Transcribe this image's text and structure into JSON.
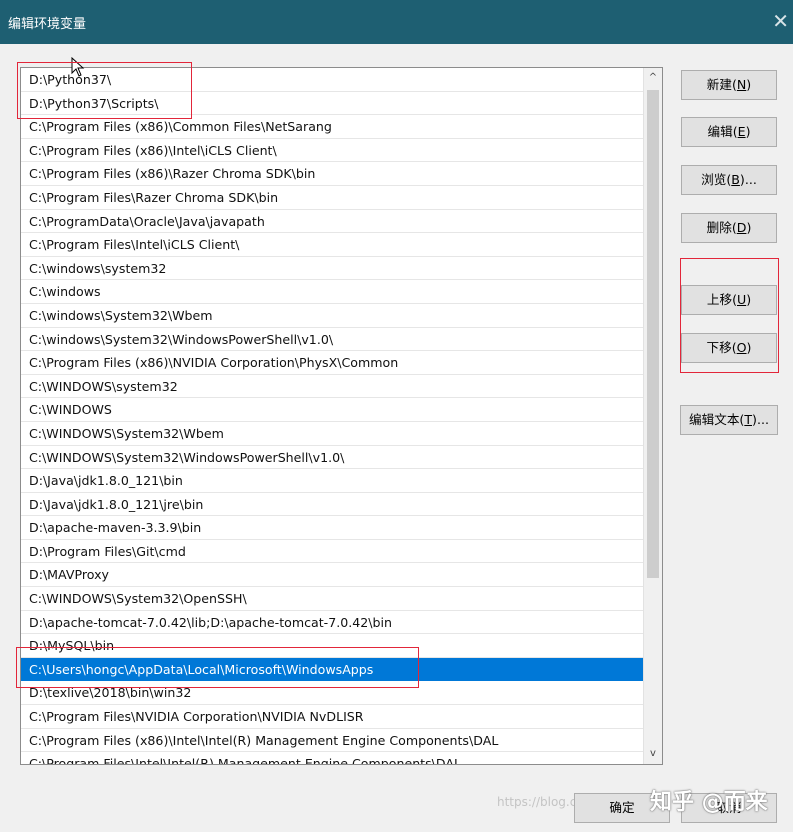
{
  "window": {
    "title": "编辑环境变量",
    "close_glyph": "✕"
  },
  "paths": [
    "D:\\Python37\\",
    "D:\\Python37\\Scripts\\",
    "C:\\Program Files (x86)\\Common Files\\NetSarang",
    "C:\\Program Files (x86)\\Intel\\iCLS Client\\",
    "C:\\Program Files (x86)\\Razer Chroma SDK\\bin",
    "C:\\Program Files\\Razer Chroma SDK\\bin",
    "C:\\ProgramData\\Oracle\\Java\\javapath",
    "C:\\Program Files\\Intel\\iCLS Client\\",
    "C:\\windows\\system32",
    "C:\\windows",
    "C:\\windows\\System32\\Wbem",
    "C:\\windows\\System32\\WindowsPowerShell\\v1.0\\",
    "C:\\Program Files (x86)\\NVIDIA Corporation\\PhysX\\Common",
    "C:\\WINDOWS\\system32",
    "C:\\WINDOWS",
    "C:\\WINDOWS\\System32\\Wbem",
    "C:\\WINDOWS\\System32\\WindowsPowerShell\\v1.0\\",
    "D:\\Java\\jdk1.8.0_121\\bin",
    "D:\\Java\\jdk1.8.0_121\\jre\\bin",
    "D:\\apache-maven-3.3.9\\bin",
    "D:\\Program Files\\Git\\cmd",
    "D:\\MAVProxy",
    "C:\\WINDOWS\\System32\\OpenSSH\\",
    "D:\\apache-tomcat-7.0.42\\lib;D:\\apache-tomcat-7.0.42\\bin",
    "D:\\MySQL\\bin",
    "C:\\Users\\hongc\\AppData\\Local\\Microsoft\\WindowsApps",
    "D:\\texlive\\2018\\bin\\win32",
    "C:\\Program Files\\NVIDIA Corporation\\NVIDIA NvDLISR",
    "C:\\Program Files (x86)\\Intel\\Intel(R) Management Engine Components\\DAL",
    "C:\\Program Files\\Intel\\Intel(R) Management Engine Components\\DAL"
  ],
  "selected_index": 25,
  "buttons": {
    "new": {
      "label": "新建",
      "hotkey": "N",
      "suffix": ""
    },
    "edit": {
      "label": "编辑",
      "hotkey": "E",
      "suffix": ""
    },
    "browse": {
      "label": "浏览",
      "hotkey": "B",
      "suffix": "..."
    },
    "delete": {
      "label": "删除",
      "hotkey": "D",
      "suffix": ""
    },
    "move_up": {
      "label": "上移",
      "hotkey": "U",
      "suffix": ""
    },
    "move_down": {
      "label": "下移",
      "hotkey": "O",
      "suffix": ""
    },
    "edit_text": {
      "label": "编辑文本",
      "hotkey": "T",
      "suffix": "..."
    }
  },
  "footer": {
    "ok_label": "确定",
    "cancel_label": "取消"
  },
  "watermark": {
    "url": "https://blog.csdn.net",
    "brand": "知乎 @而来"
  },
  "colors": {
    "titlebar": "#1e5f72",
    "selection": "#0078d7",
    "highlight": "#e2263a"
  },
  "icons": {
    "scroll_up": "^",
    "scroll_down": "v"
  }
}
